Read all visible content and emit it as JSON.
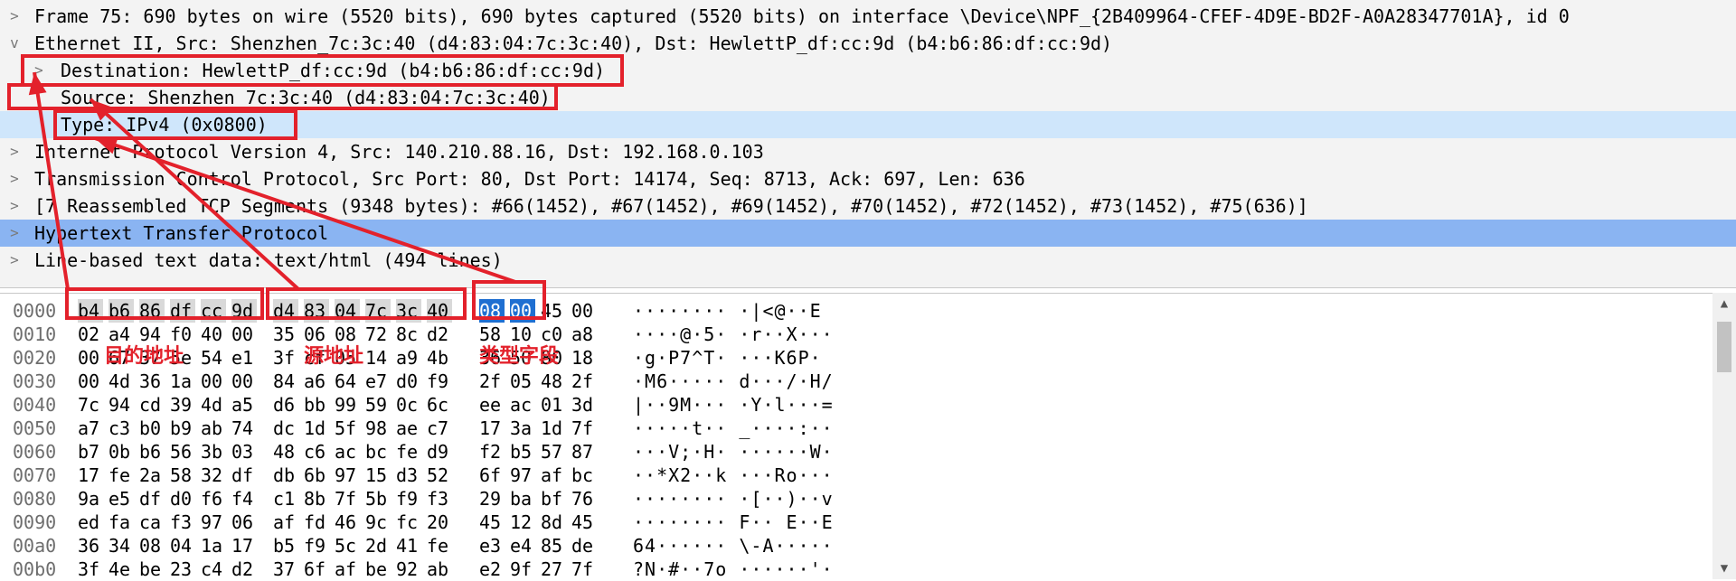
{
  "tree": [
    {
      "text": "Frame 75: 690 bytes on wire (5520 bits), 690 bytes captured (5520 bits) on interface \\Device\\NPF_{2B409964-CFEF-4D9E-BD2F-A0A28347701A}, id 0",
      "expander": ">"
    },
    {
      "text": "Ethernet II, Src: Shenzhen_7c:3c:40 (d4:83:04:7c:3c:40), Dst: HewlettP_df:cc:9d (b4:b6:86:df:cc:9d)",
      "expander": "v"
    },
    {
      "text": "Destination: HewlettP_df:cc:9d (b4:b6:86:df:cc:9d)",
      "expander": ">"
    },
    {
      "text": "Source: Shenzhen_7c:3c:40 (d4:83:04:7c:3c:40)",
      "expander": ""
    },
    {
      "text": "Type: IPv4 (0x0800)",
      "expander": ""
    },
    {
      "text": "Internet Protocol Version 4, Src: 140.210.88.16, Dst: 192.168.0.103",
      "expander": ">"
    },
    {
      "text": "Transmission Control Protocol, Src Port: 80, Dst Port: 14174, Seq: 8713, Ack: 697, Len: 636",
      "expander": ">"
    },
    {
      "text": "[7 Reassembled TCP Segments (9348 bytes): #66(1452), #67(1452), #69(1452), #70(1452), #72(1452), #73(1452), #75(636)]",
      "expander": ">"
    },
    {
      "text": "Hypertext Transfer Protocol",
      "expander": ">"
    },
    {
      "text": "Line-based text data: text/html (494 lines)",
      "expander": ">"
    }
  ],
  "hex": [
    {
      "offset": "0000",
      "bytes": [
        "b4",
        "b6",
        "86",
        "df",
        "cc",
        "9d",
        "d4",
        "83",
        "04",
        "7c",
        "3c",
        "40",
        "08",
        "00",
        "45",
        "00"
      ],
      "ascii": "········ ·|<@··E"
    },
    {
      "offset": "0010",
      "bytes": [
        "02",
        "a4",
        "94",
        "f0",
        "40",
        "00",
        "35",
        "06",
        "08",
        "72",
        "8c",
        "d2",
        "58",
        "10",
        "c0",
        "a8"
      ],
      "ascii": "····@·5· ·r··X···"
    },
    {
      "offset": "0020",
      "bytes": [
        "00",
        "67",
        "37",
        "5e",
        "54",
        "e1",
        "3f",
        "cf",
        "05",
        "14",
        "a9",
        "4b",
        "36",
        "50",
        "80",
        "18"
      ],
      "ascii": "·g·P7^T· ···K6P·"
    },
    {
      "offset": "0030",
      "bytes": [
        "00",
        "4d",
        "36",
        "1a",
        "00",
        "00",
        "84",
        "a6",
        "64",
        "e7",
        "d0",
        "f9",
        "2f",
        "05",
        "48",
        "2f"
      ],
      "ascii": "·M6····· d···/·H/"
    },
    {
      "offset": "0040",
      "bytes": [
        "7c",
        "94",
        "cd",
        "39",
        "4d",
        "a5",
        "d6",
        "bb",
        "99",
        "59",
        "0c",
        "6c",
        "ee",
        "ac",
        "01",
        "3d"
      ],
      "ascii": "|··9M··· ·Y·l···="
    },
    {
      "offset": "0050",
      "bytes": [
        "a7",
        "c3",
        "b0",
        "b9",
        "ab",
        "74",
        "dc",
        "1d",
        "5f",
        "98",
        "ae",
        "c7",
        "17",
        "3a",
        "1d",
        "7f"
      ],
      "ascii": "·····t·· _····:··"
    },
    {
      "offset": "0060",
      "bytes": [
        "b7",
        "0b",
        "b6",
        "56",
        "3b",
        "03",
        "48",
        "c6",
        "ac",
        "bc",
        "fe",
        "d9",
        "f2",
        "b5",
        "57",
        "87"
      ],
      "ascii": "···V;·H· ······W·"
    },
    {
      "offset": "0070",
      "bytes": [
        "17",
        "fe",
        "2a",
        "58",
        "32",
        "df",
        "db",
        "6b",
        "97",
        "15",
        "d3",
        "52",
        "6f",
        "97",
        "af",
        "bc"
      ],
      "ascii": "··*X2··k ···Ro···"
    },
    {
      "offset": "0080",
      "bytes": [
        "9a",
        "e5",
        "df",
        "d0",
        "f6",
        "f4",
        "c1",
        "8b",
        "7f",
        "5b",
        "f9",
        "f3",
        "29",
        "ba",
        "bf",
        "76"
      ],
      "ascii": "········ ·[··)··v"
    },
    {
      "offset": "0090",
      "bytes": [
        "ed",
        "fa",
        "ca",
        "f3",
        "97",
        "06",
        "af",
        "fd",
        "46",
        "9c",
        "fc",
        "20",
        "45",
        "12",
        "8d",
        "45"
      ],
      "ascii": "········ F·· E··E"
    },
    {
      "offset": "00a0",
      "bytes": [
        "36",
        "34",
        "08",
        "04",
        "1a",
        "17",
        "b5",
        "f9",
        "5c",
        "2d",
        "41",
        "fe",
        "e3",
        "e4",
        "85",
        "de"
      ],
      "ascii": "64······ \\-A·····"
    },
    {
      "offset": "00b0",
      "bytes": [
        "3f",
        "4e",
        "be",
        "23",
        "c4",
        "d2",
        "37",
        "6f",
        "af",
        "be",
        "92",
        "ab",
        "e2",
        "9f",
        "27",
        "7f"
      ],
      "ascii": "?N·#··7o ······'·"
    }
  ],
  "annotations": {
    "dest_label": "目的地址",
    "src_label": "源地址",
    "type_label": "类型字段"
  },
  "colors": {
    "annotation": "#e3212b",
    "selected_row": "#cfe6fb",
    "highlight_row": "#8ab4f2",
    "byte_selected": "#1f6fd1"
  },
  "scrollbar": {
    "up": "▲",
    "down": "▼"
  }
}
